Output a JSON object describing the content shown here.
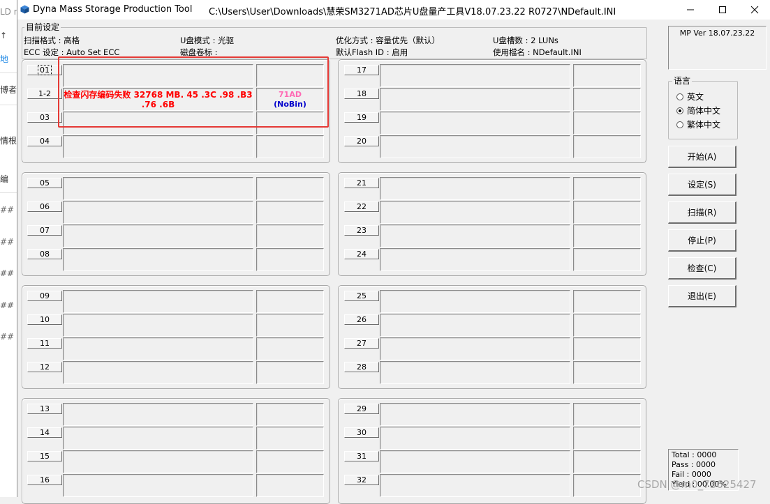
{
  "background": {
    "fragments": [
      "LD n",
      "↑",
      "地",
      "博者",
      "情根",
      "编",
      "##",
      "##",
      "##",
      "##",
      "##"
    ]
  },
  "window": {
    "title": "Dyna Mass Storage Production Tool",
    "path": "C:\\Users\\User\\Downloads\\慧荣SM3271AD芯片U盘量产工具V18.07.23.22 R0727\\NDefault.INI",
    "controls": [
      "minimize-icon",
      "maximize-icon",
      "close-icon"
    ]
  },
  "settings": {
    "group_title": "目前设定",
    "scan_format": "扫描格式 : 高格",
    "udisk_mode": "U盘模式 : 光驱",
    "optimize": "优化方式 : 容量优先（默认）",
    "slot_count": "U盘槽数 : 2 LUNs",
    "ecc": "ECC 设定 : Auto Set ECC",
    "volume": "磁盘卷标 :",
    "flash_id": "默认Flash ID : 启用",
    "file_name": "使用檔名 : NDefault.INI"
  },
  "ports": {
    "p01": "01",
    "p02": "1-2",
    "p03": "03",
    "p04": "04",
    "p05": "05",
    "p06": "06",
    "p07": "07",
    "p08": "08",
    "p09": "09",
    "p10": "10",
    "p11": "11",
    "p12": "12",
    "p13": "13",
    "p14": "14",
    "p15": "15",
    "p16": "16",
    "p17": "17",
    "p18": "18",
    "p19": "19",
    "p20": "20",
    "p21": "21",
    "p22": "22",
    "p23": "23",
    "p24": "24",
    "p25": "25",
    "p26": "26",
    "p27": "27",
    "p28": "28",
    "p29": "29",
    "p30": "30",
    "p31": "31",
    "p32": "32"
  },
  "port_status": {
    "line1": "检查闪存编码失败  32768 MB. 45 .3C .98 .B3",
    "line2": ".76 .6B",
    "chip_id": "71AD",
    "bin": "(NoBin)",
    "status_color": "#ff0000",
    "chip_color": "#ff69b4",
    "bin_color": "#0000cc"
  },
  "version": "MP Ver 18.07.23.22",
  "language": {
    "title": "语言",
    "options": [
      "英文",
      "简体中文",
      "繁体中文"
    ],
    "selected": "简体中文"
  },
  "actions": {
    "start": "开始(A)",
    "settings": "设定(S)",
    "scan": "扫描(R)",
    "stop": "停止(P)",
    "check": "检查(C)",
    "exit": "退出(E)"
  },
  "stats": {
    "total": "Total : 0000",
    "pass": "Pass : 0000",
    "fail": "Fail   : 0000",
    "yield": "Yield : 00.00%"
  },
  "watermark": "CSDN @m0_73625427",
  "colors": {
    "highlight": "#e53935",
    "window_bg": "#f0f0f0",
    "app_icon": "#1f5fa8"
  }
}
